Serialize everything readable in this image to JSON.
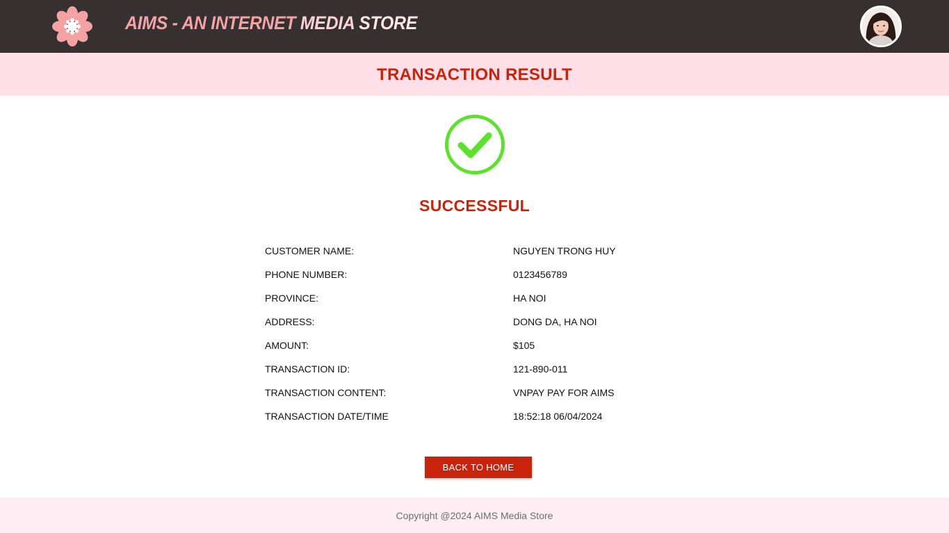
{
  "header": {
    "logo_icon": "flower-logo-icon",
    "title_part1": "AIMS - AN INTERNET ",
    "title_part2": "MEDIA",
    "title_part3": " STORE",
    "avatar_icon": "user-avatar-icon"
  },
  "banner": {
    "title": "TRANSACTION RESULT"
  },
  "result": {
    "icon": "check-circle-icon",
    "status": "SUCCESSFUL",
    "status_color": "#c8240b",
    "icon_color": "#5ce12c"
  },
  "details": [
    {
      "label": "CUSTOMER NAME:",
      "value": "NGUYEN TRONG HUY"
    },
    {
      "label": "PHONE NUMBER:",
      "value": "0123456789"
    },
    {
      "label": "PROVINCE:",
      "value": "HA NOI"
    },
    {
      "label": "ADDRESS:",
      "value": "DONG DA, HA NOI"
    },
    {
      "label": "AMOUNT:",
      "value": "$105"
    },
    {
      "label": "TRANSACTION ID:",
      "value": "121-890-011"
    },
    {
      "label": "TRANSACTION CONTENT:",
      "value": "VNPAY PAY FOR AIMS"
    },
    {
      "label": "TRANSACTION DATE/TIME",
      "value": "18:52:18 06/04/2024"
    }
  ],
  "actions": {
    "back_label": "BACK TO HOME"
  },
  "footer": {
    "copyright": "Copyright @2024 AIMS Media Store"
  },
  "colors": {
    "header_bg": "#363031",
    "banner_bg": "#ffdfe8",
    "accent": "#c8230b",
    "footer_bg": "#ffeef3"
  }
}
